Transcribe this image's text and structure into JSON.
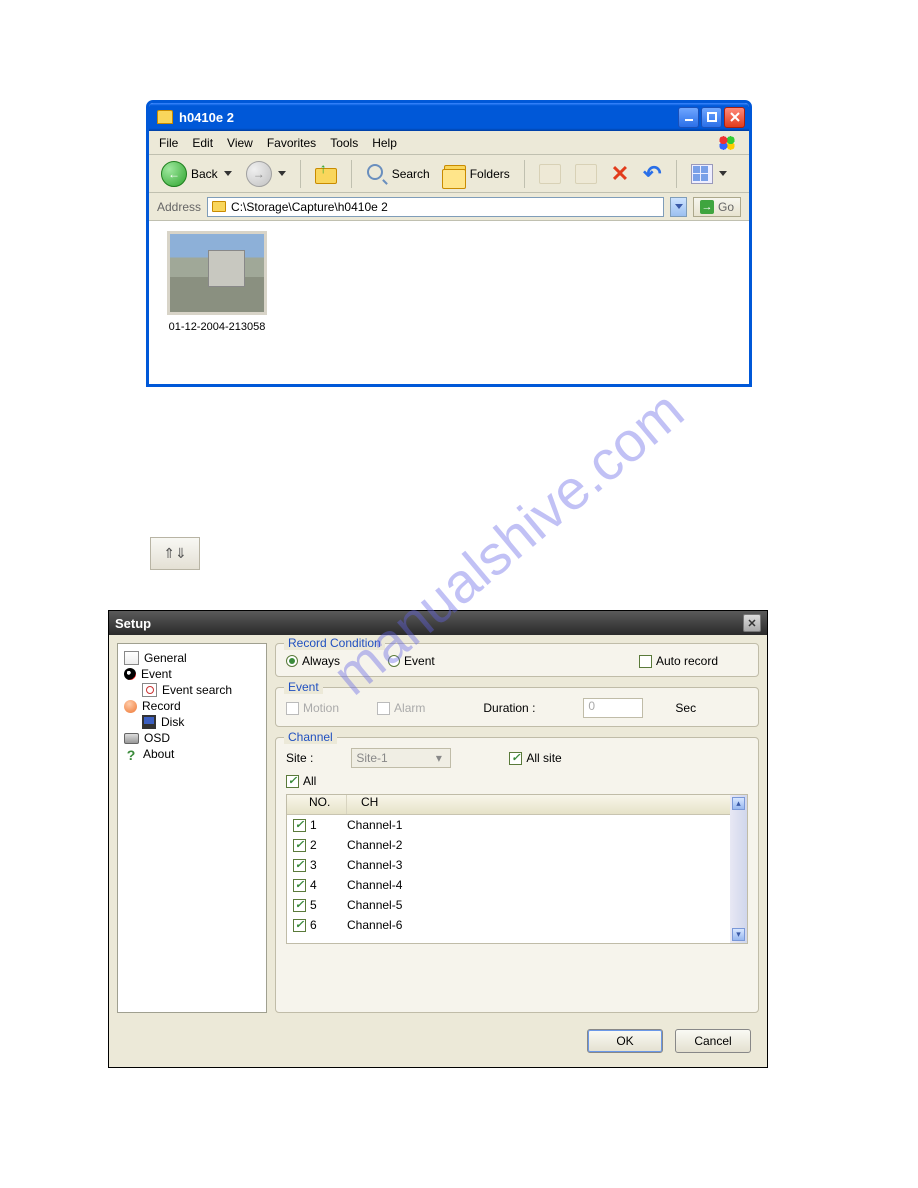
{
  "watermark": "manualshive.com",
  "explorer": {
    "title": "h0410e 2",
    "menu": [
      "File",
      "Edit",
      "View",
      "Favorites",
      "Tools",
      "Help"
    ],
    "toolbar": {
      "back": "Back",
      "search": "Search",
      "folders": "Folders"
    },
    "address": {
      "label": "Address",
      "path": "C:\\Storage\\Capture\\h0410e 2",
      "go": "Go"
    },
    "thumb_label": "01-12-2004-213058"
  },
  "smallbtn": {
    "glyph": "⇑⇓"
  },
  "setup": {
    "title": "Setup",
    "tree": {
      "general": "General",
      "event": "Event",
      "event_search": "Event search",
      "record": "Record",
      "disk": "Disk",
      "osd": "OSD",
      "about": "About"
    },
    "record_condition": {
      "title": "Record Condition",
      "always": "Always",
      "event": "Event",
      "auto": "Auto record"
    },
    "event_group": {
      "title": "Event",
      "motion": "Motion",
      "alarm": "Alarm",
      "duration_label": "Duration :",
      "duration_value": "0",
      "sec": "Sec"
    },
    "channel_group": {
      "title": "Channel",
      "site_label": "Site :",
      "site_value": "Site-1",
      "all_site": "All site",
      "all": "All",
      "head_no": "NO.",
      "head_ch": "CH",
      "rows": [
        {
          "no": "1",
          "ch": "Channel-1"
        },
        {
          "no": "2",
          "ch": "Channel-2"
        },
        {
          "no": "3",
          "ch": "Channel-3"
        },
        {
          "no": "4",
          "ch": "Channel-4"
        },
        {
          "no": "5",
          "ch": "Channel-5"
        },
        {
          "no": "6",
          "ch": "Channel-6"
        }
      ]
    },
    "ok": "OK",
    "cancel": "Cancel"
  }
}
